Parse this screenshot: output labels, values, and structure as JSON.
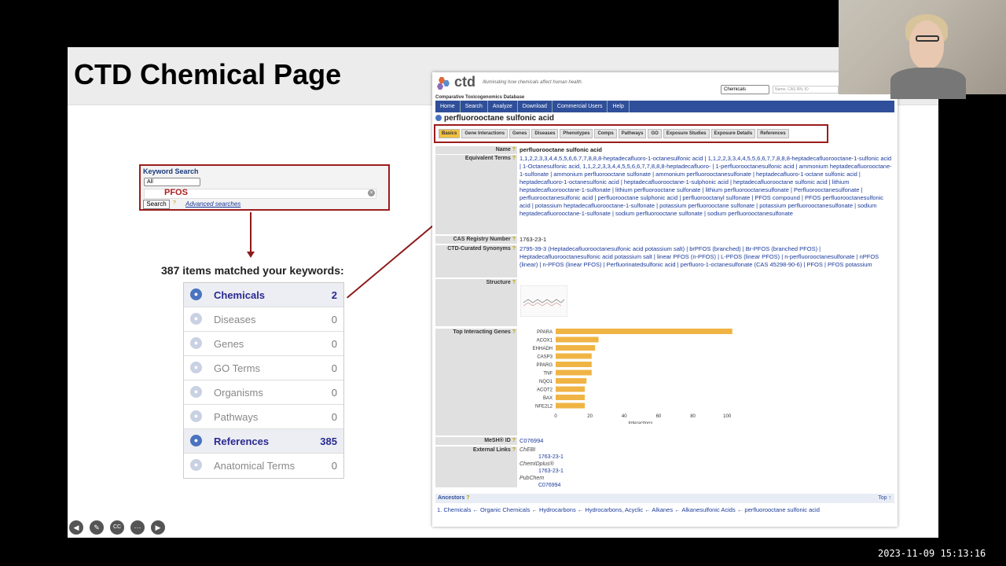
{
  "slide": {
    "title": "CTD Chemical Page"
  },
  "keyword_search": {
    "title": "Keyword Search",
    "scope": "All",
    "value": "PFOS",
    "search_label": "Search",
    "help": "?",
    "advanced_label": "Advanced searches"
  },
  "results": {
    "summary": "387 items matched your keywords:",
    "rows": [
      {
        "label": "Chemicals",
        "count": "2",
        "icon": "chemical-icon"
      },
      {
        "label": "Diseases",
        "count": "0",
        "icon": "disease-icon"
      },
      {
        "label": "Genes",
        "count": "0",
        "icon": "gene-icon"
      },
      {
        "label": "GO Terms",
        "count": "0",
        "icon": "go-icon"
      },
      {
        "label": "Organisms",
        "count": "0",
        "icon": "organism-icon"
      },
      {
        "label": "Pathways",
        "count": "0",
        "icon": "pathway-icon"
      },
      {
        "label": "References",
        "count": "385",
        "icon": "reference-icon"
      },
      {
        "label": "Anatomical Terms",
        "count": "0",
        "icon": "anatomy-icon"
      }
    ]
  },
  "ctd": {
    "logo": "ctd",
    "tagline": "Illuminating how chemicals affect human health.",
    "subtitle": "Comparative Toxicogenomics Database",
    "search_scope": "Chemicals",
    "search_placeholder": "Name, CAS RN, ID",
    "nav": [
      "Home",
      "Search",
      "Analyze",
      "Download",
      "Commercial Users",
      "Help"
    ],
    "chemical_name": "perfluorooctane sulfonic acid",
    "tabs": [
      "Basics",
      "Gene Interactions",
      "Genes",
      "Diseases",
      "Phenotypes",
      "Comps",
      "Pathways",
      "GO",
      "Exposure Studies",
      "Exposure Details",
      "References"
    ],
    "labels": {
      "name": "Name",
      "equiv": "Equivalent Terms",
      "cas": "CAS Registry Number",
      "synonyms": "CTD-Curated Synonyms",
      "structure": "Structure",
      "top_genes": "Top Interacting Genes",
      "mesh": "MeSH® ID",
      "external": "External Links"
    },
    "name_value": "perfluorooctane sulfonic acid",
    "equiv_value": "1,1,2,2,3,3,4,4,5,5,6,6,7,7,8,8,8-heptadecafluoro-1-octanesulfonic acid | 1,1,2,2,3,3,4,4,5,5,6,6,7,7,8,8,8-heptadecafluorooctane-1-sulfonic acid | 1-Octanesulfonic acid, 1,1,2,2,3,3,4,4,5,5,6,6,7,7,8,8,8-heptadecafluoro- | 1-perfluorooctanesulfonic acid | ammonium heptadecafluorooctane-1-sulfonate | ammonium perfluorooctane sulfonate | ammonium perfluorooctanesulfonate | heptadecafluoro-1-octane sulfonic acid | heptadecafluoro-1-octanesulfonic acid | heptadecafluorooctane-1-sulphonic acid | heptadecafluorooctane sulfonic acid | lithium heptadecafluorooctane-1-sulfonate | lithium perfluorooctane sulfonate | lithium perfluorooctanesulfonate | Perfluorooctanesulfonate | perfluorooctanesulfonic acid | perfluorooctane sulphonic acid | perfluorooctanyl sulfonate | PFOS compound | PFOS perfluorooctanesulfonic acid | potassium heptadecafluorooctane-1-sulfonate | potassium perfluorooctane sulfonate | potassium perfluorooctanesulfonate | sodium heptadecafluorooctane-1-sulfonate | sodium perfluorooctane sulfonate | sodium perfluorooctanesulfonate",
    "cas_value": "1763-23-1",
    "synonyms_value": "2795-39-3 (Heptadecafluorooctanesulfonic acid potassium salt) | brPFOS (branched) | Br-PFOS (branched PFOS) | Heptadecafluorooctanesulfonic acid potassium salt | linear PFOS (n-PFOS) | L-PFOS (linear PFOS) | n-perfluorooctanesulfonate | nPFOS (linear) | n-PFOS (linear PFOS) | Perfluorinatedsulfonic acid | perfluoro-1-octanesulfonate (CAS 45298-90-6) | PFOS | PFOS potassium",
    "mesh_value": "C076994",
    "external_links": [
      {
        "source": "ChEBI",
        "id": "1763-23-1"
      },
      {
        "source": "ChemIDplus®",
        "id": "1763-23-1"
      },
      {
        "source": "PubChem",
        "id": "C076994"
      }
    ],
    "ancestors_label": "Ancestors",
    "top_label": "Top ↑",
    "ancestors_path": "1. Chemicals ← Organic Chemicals ← Hydrocarbons ← Hydrocarbons, Acyclic ← Alkanes ← Alkanesulfonic Acids ← perfluorooctane sulfonic acid"
  },
  "chart_data": {
    "type": "bar",
    "orientation": "horizontal",
    "categories": [
      "PPARA",
      "ACOX1",
      "EHHADH",
      "CASP3",
      "PPARG",
      "TNF",
      "NQO1",
      "ACOT2",
      "BAX",
      "NFE2L2"
    ],
    "values": [
      103,
      25,
      23,
      21,
      21,
      21,
      18,
      17,
      17,
      17
    ],
    "xlabel": "Interactions",
    "xticks": [
      "0",
      "20",
      "40",
      "60",
      "80",
      "100"
    ],
    "xlim": [
      0,
      110
    ],
    "color": "#f0b445"
  },
  "bottom_controls": [
    "prev-icon",
    "pen-icon",
    "cc-icon",
    "more-icon",
    "next-icon"
  ],
  "timestamp": "2023-11-09  15:13:16"
}
